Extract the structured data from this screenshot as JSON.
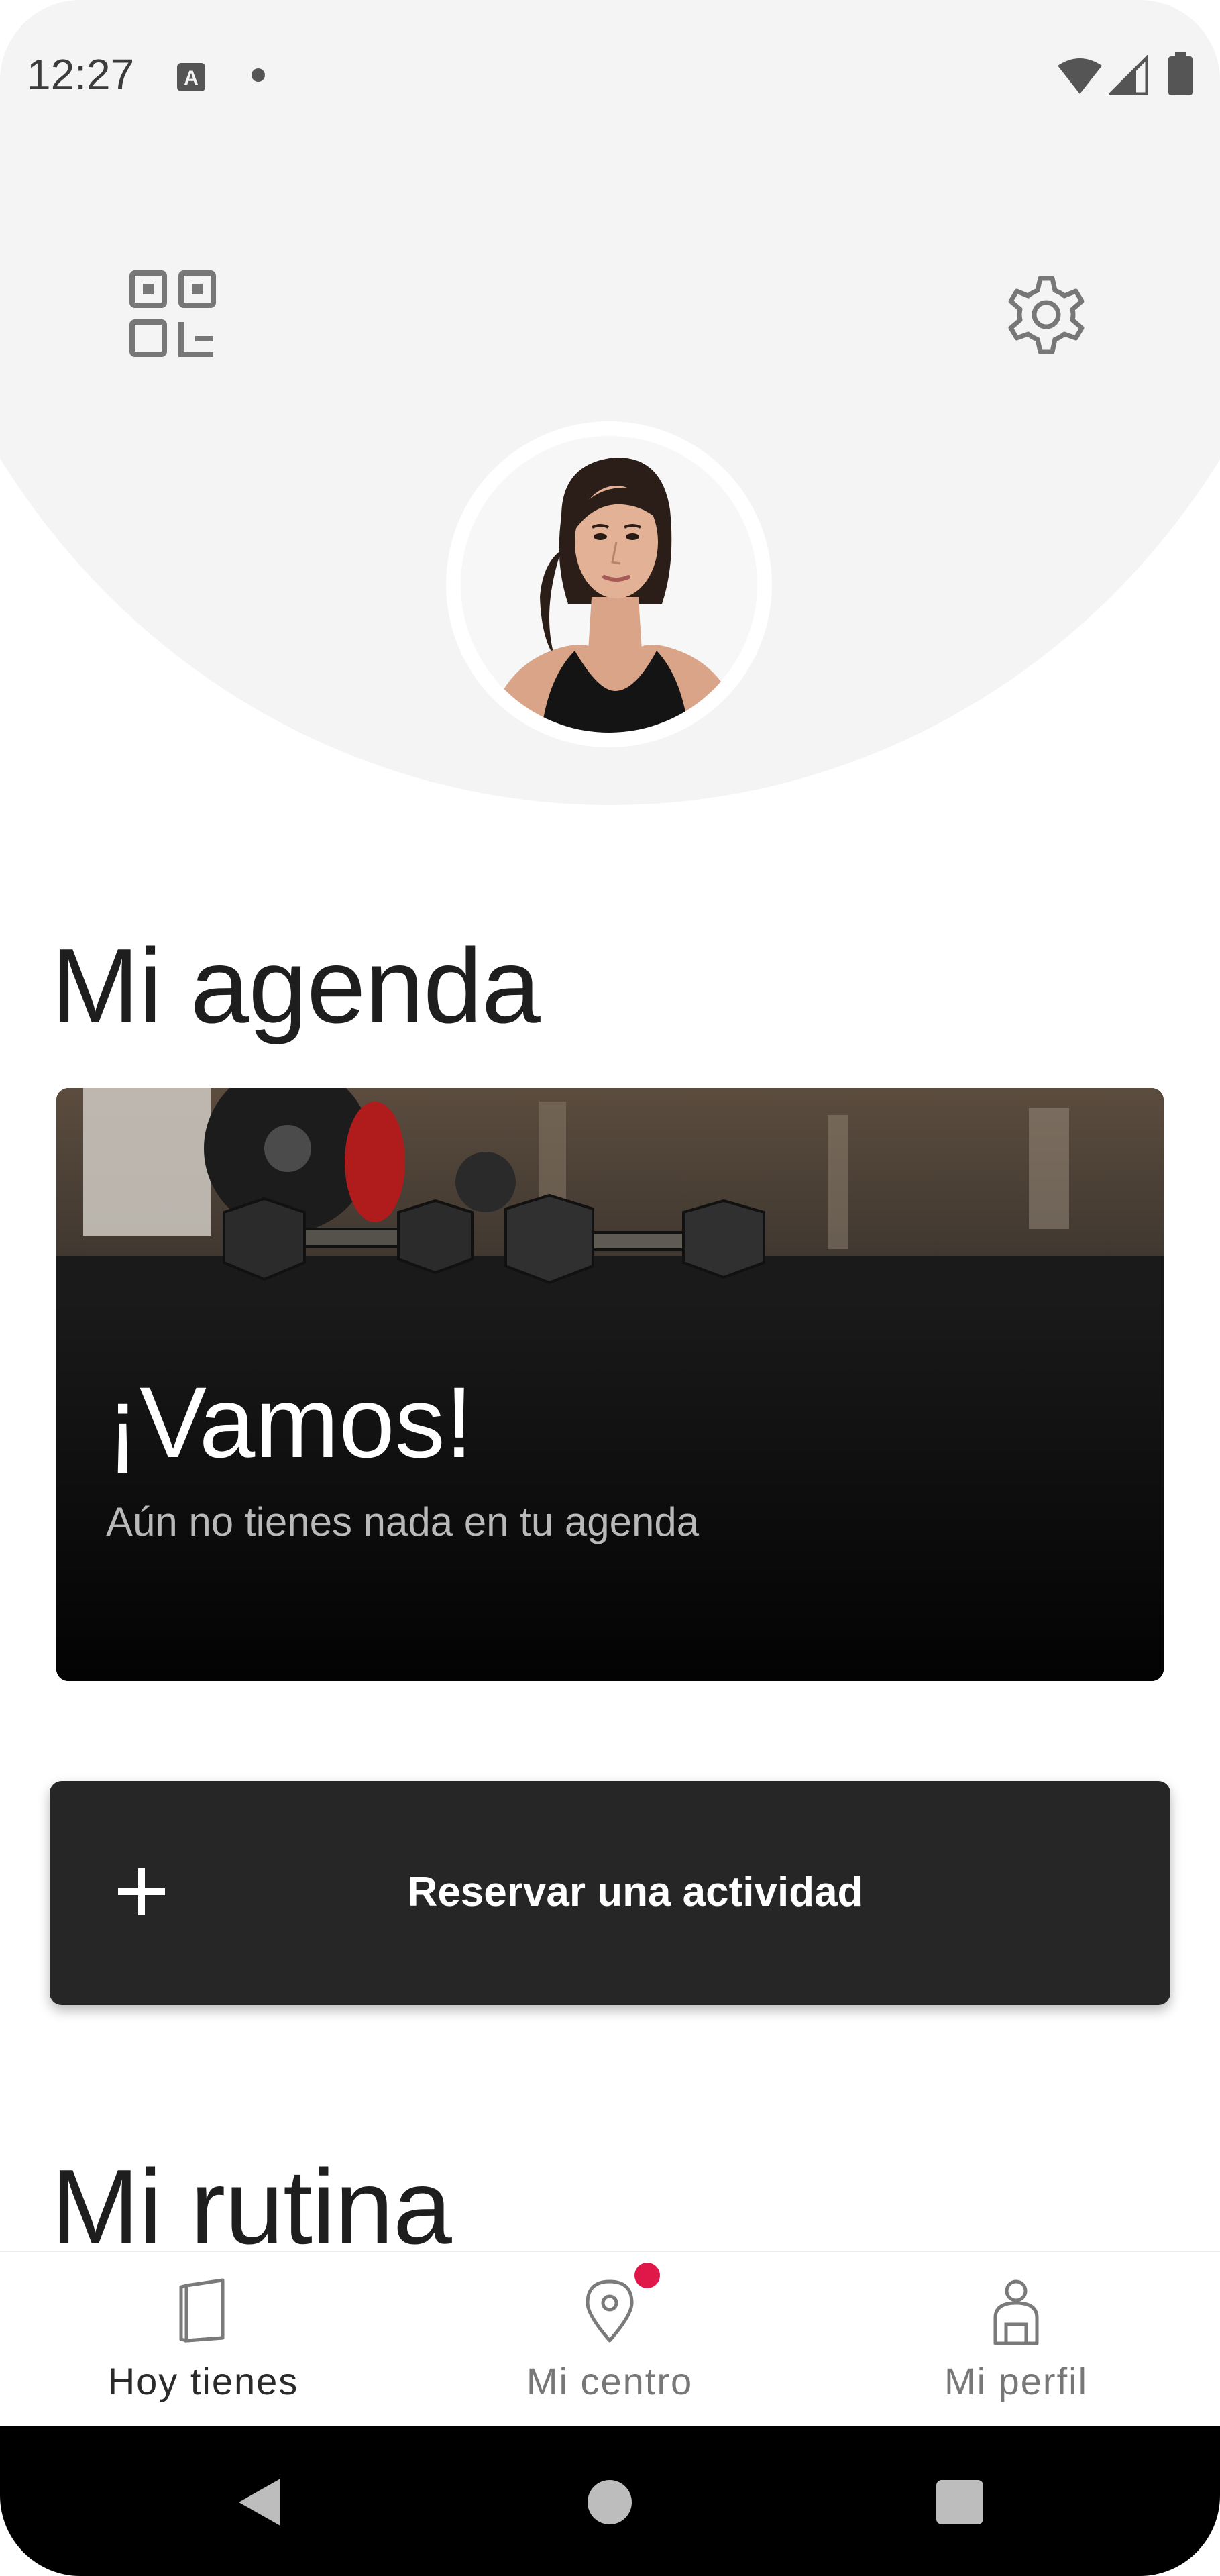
{
  "status_bar": {
    "time": "12:27",
    "icons": [
      "keyboard-a-icon",
      "notification-dot-icon",
      "wifi-icon",
      "signal-icon",
      "battery-icon"
    ]
  },
  "header": {
    "left_icon": "qr-code-icon",
    "right_icon": "settings-gear-icon",
    "avatar": "profile-photo"
  },
  "agenda": {
    "title": "Mi agenda",
    "card_heading": "¡Vamos!",
    "card_subtitle": "Aún no tienes nada en tu agenda"
  },
  "reserve_button": {
    "icon": "plus-icon",
    "label": "Reservar una actividad"
  },
  "routine": {
    "title": "Mi rutina"
  },
  "bottom_nav": {
    "items": [
      {
        "label": "Hoy tienes",
        "icon": "notebook-icon",
        "active": true
      },
      {
        "label": "Mi centro",
        "icon": "location-pin-icon",
        "badge": true
      },
      {
        "label": "Mi perfil",
        "icon": "person-icon"
      }
    ]
  },
  "colors": {
    "header_bg": "#f4f4f4",
    "button_bg": "#262626",
    "badge": "#e0184a",
    "system_nav": "#000000"
  }
}
